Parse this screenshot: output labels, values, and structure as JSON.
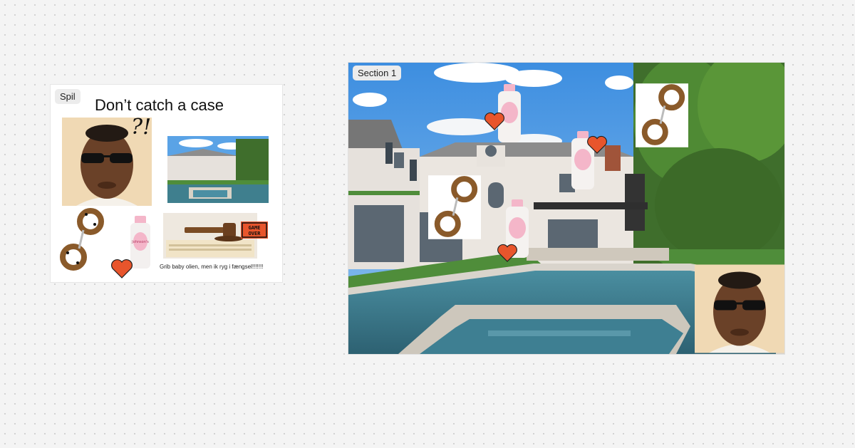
{
  "canvas": {
    "left_frame": {
      "label": "Spil",
      "title": "Don’t catch a case",
      "scribble": "?!",
      "caption": "Grib baby olien, men ik ryg i fængsel!!!!!!!",
      "game_over_badge": "GAME OVER"
    },
    "right_frame": {
      "label": "Section 1"
    },
    "products": {
      "baby_oil_brand": "Johnson's",
      "baby_oil_word": "baby"
    }
  },
  "colors": {
    "heart": "#e8552c",
    "sky": "#5aa3e6",
    "pool": "#3f7f8e",
    "lawn": "#4f8d3a",
    "hedge": "#3f6e2c",
    "house": "#e6e1dc",
    "leopard": "#8a5a2a"
  }
}
